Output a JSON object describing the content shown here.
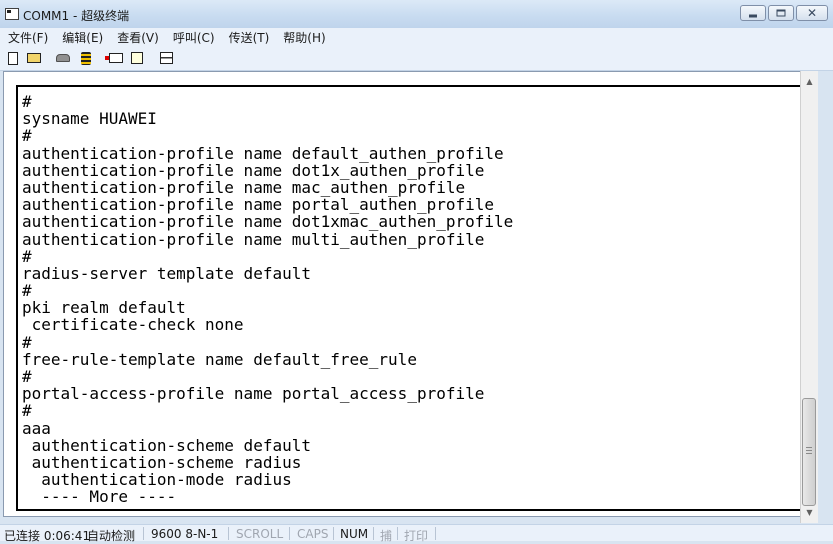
{
  "window": {
    "title": "COMM1 - 超级终端"
  },
  "menu": {
    "items": [
      "文件(F)",
      "编辑(E)",
      "查看(V)",
      "呼叫(C)",
      "传送(T)",
      "帮助(H)"
    ]
  },
  "toolbar": {
    "icons": [
      "new-icon",
      "open-icon",
      "call-icon",
      "disconnect-icon",
      "send-icon",
      "receive-icon",
      "properties-icon"
    ]
  },
  "terminal": {
    "lines": [
      "#",
      "sysname HUAWEI",
      "#",
      "authentication-profile name default_authen_profile",
      "authentication-profile name dot1x_authen_profile",
      "authentication-profile name mac_authen_profile",
      "authentication-profile name portal_authen_profile",
      "authentication-profile name dot1xmac_authen_profile",
      "authentication-profile name multi_authen_profile",
      "#",
      "radius-server template default",
      "#",
      "pki realm default",
      " certificate-check none",
      "#",
      "free-rule-template name default_free_rule",
      "#",
      "portal-access-profile name portal_access_profile",
      "#",
      "aaa",
      " authentication-scheme default",
      " authentication-scheme radius",
      "  authentication-mode radius",
      "  ---- More ----"
    ]
  },
  "status": {
    "connection": "已连接 0:06:41",
    "detect": "自动检测",
    "port_settings": "9600 8-N-1",
    "scroll": "SCROLL",
    "caps": "CAPS",
    "num": "NUM",
    "capture": "捕",
    "print": "打印"
  }
}
